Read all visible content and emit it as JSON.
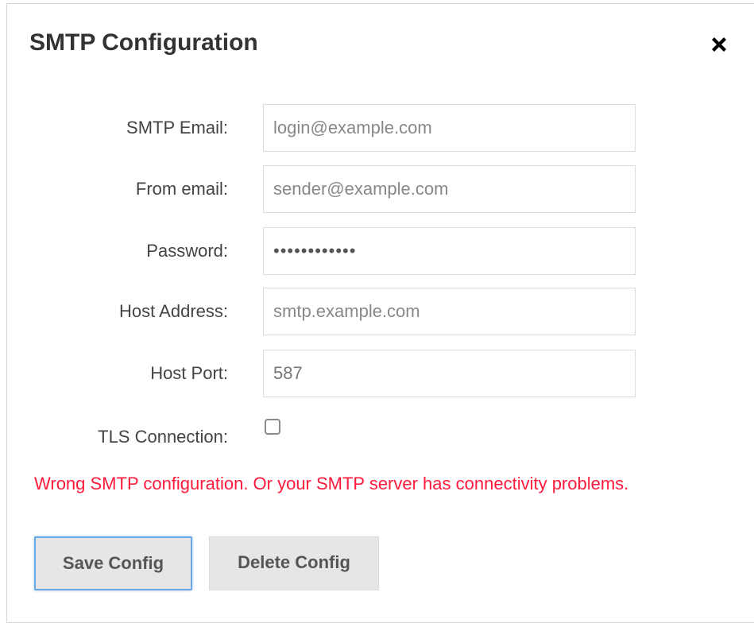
{
  "dialog": {
    "title": "SMTP Configuration",
    "close_icon": "close-x-icon"
  },
  "fields": [
    {
      "label": "SMTP Email:",
      "placeholder": "login@example.com",
      "value": ""
    },
    {
      "label": "From email:",
      "placeholder": "sender@example.com",
      "value": ""
    },
    {
      "label": "Password:",
      "placeholder": "",
      "value": "••••••••••••"
    },
    {
      "label": "Host Address:",
      "placeholder": "smtp.example.com",
      "value": ""
    },
    {
      "label": "Host Port:",
      "placeholder": "",
      "value": "587"
    }
  ],
  "tls": {
    "label": "TLS Connection:",
    "checked": false
  },
  "error_message": "Wrong SMTP configuration. Or your SMTP server has connectivity problems.",
  "buttons": {
    "save_label": "Save Config",
    "delete_label": "Delete Config"
  },
  "colors": {
    "error": "#ff1a3c",
    "focus_border": "#6aa7e6",
    "button_bg": "#e6e6e6"
  }
}
